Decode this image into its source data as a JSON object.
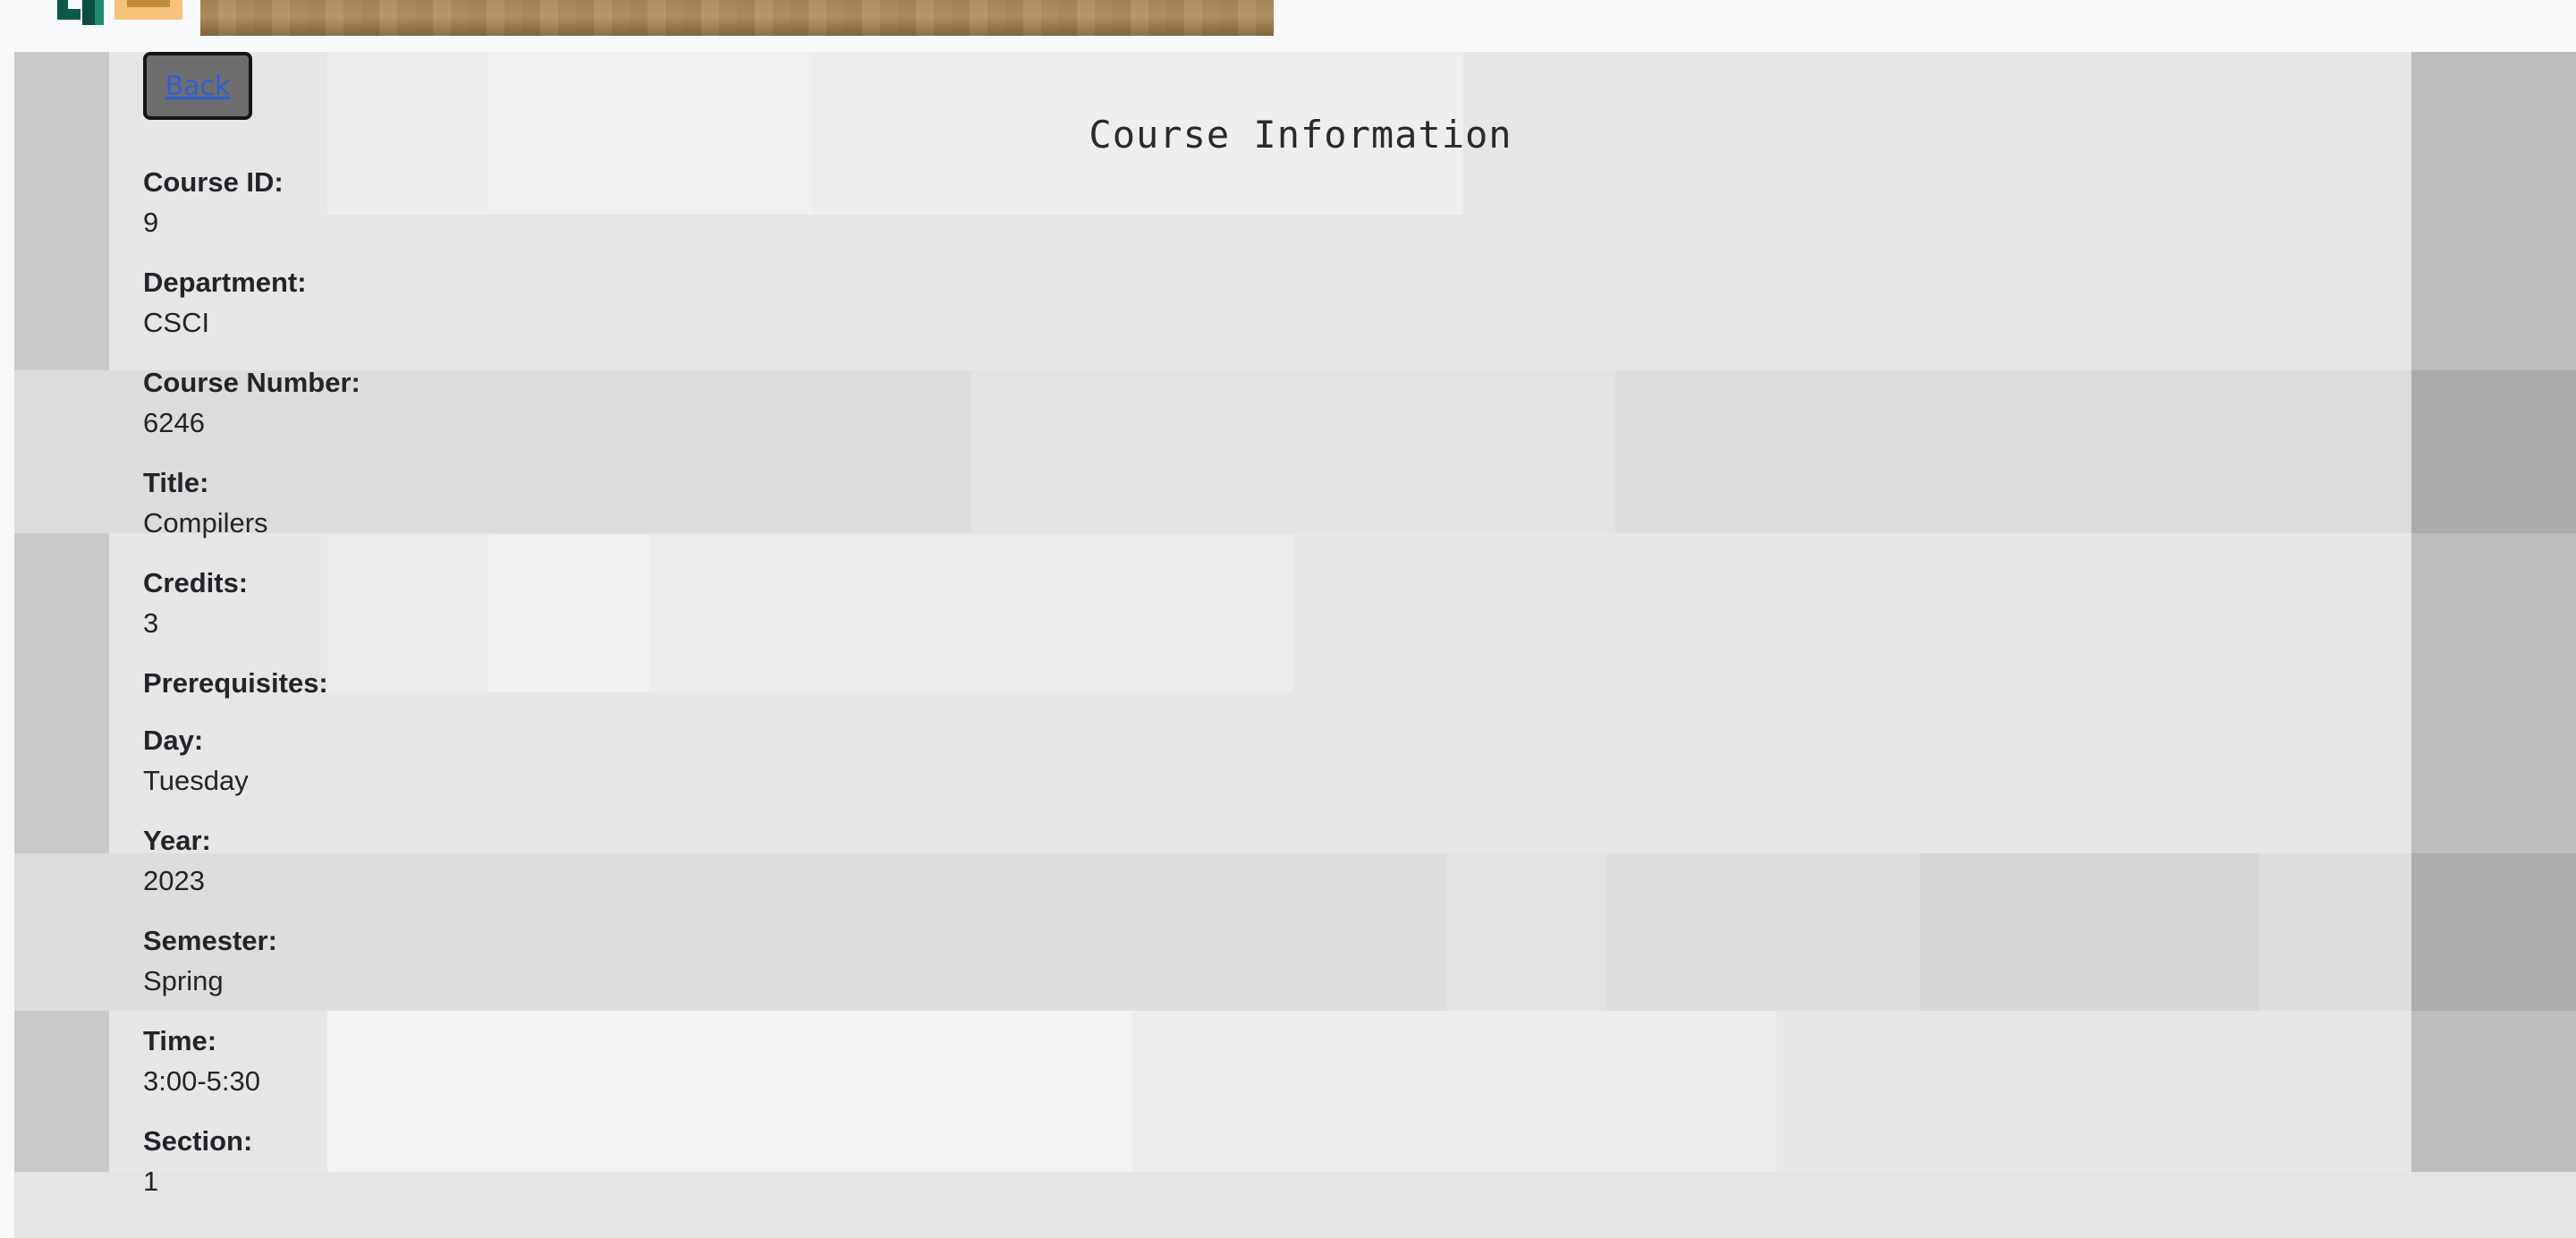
{
  "header": {
    "logo_icon": "pixel-logo-icon",
    "banner_icon": "wood-plank-banner"
  },
  "page": {
    "back_label": "Back",
    "title": "Course Information"
  },
  "course": {
    "fields": [
      {
        "label": "Course ID:",
        "value": "9"
      },
      {
        "label": "Department:",
        "value": "CSCI"
      },
      {
        "label": "Course Number:",
        "value": "6246"
      },
      {
        "label": "Title:",
        "value": "Compilers"
      },
      {
        "label": "Credits:",
        "value": "3"
      },
      {
        "label": "Prerequisites:",
        "value": ""
      },
      {
        "label": "Day:",
        "value": "Tuesday"
      },
      {
        "label": "Year:",
        "value": "2023"
      },
      {
        "label": "Semester:",
        "value": "Spring"
      },
      {
        "label": "Time:",
        "value": "3:00-5:30"
      },
      {
        "label": "Section:",
        "value": "1"
      }
    ]
  },
  "colors": {
    "link": "#2f5fd0",
    "button_bg": "#6e6e6e",
    "panel_bg": "#e7e7e7",
    "banner": "#a8895a"
  }
}
